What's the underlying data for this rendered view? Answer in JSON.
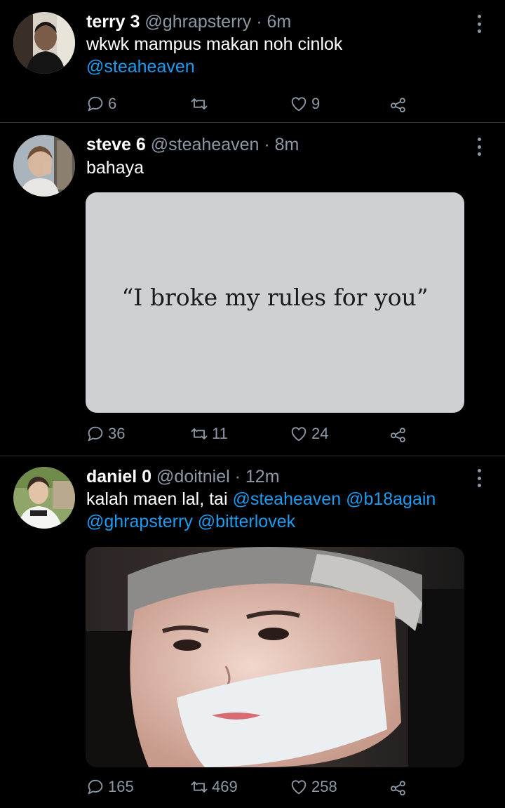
{
  "tweets": [
    {
      "name": "terry 3",
      "handle": "@ghrapsterry",
      "time": "· 6m",
      "text": "wkwk mampus makan noh cinlok",
      "mentions_line": "@steaheaven",
      "replies": "6",
      "retweets": "",
      "likes": "9"
    },
    {
      "name": "steve 6",
      "handle": "@steaheaven",
      "time": "· 8m",
      "text": "bahaya",
      "image_quote": "“I broke my rules for you”",
      "replies": "36",
      "retweets": "11",
      "likes": "24"
    },
    {
      "name": "daniel 0",
      "handle": "@doitniel",
      "time": "· 12m",
      "text_prefix": "kalah maen lal, tai ",
      "mention_a": "@steaheaven",
      "mention_b": "@b18again",
      "mention_c": "@ghrapsterry",
      "mention_d": "@bitterlovek",
      "replies": "165",
      "retweets": "469",
      "likes": "258"
    }
  ],
  "colors": {
    "background": "#000000",
    "mention": "#1d9bf0",
    "muted": "#8b98a5",
    "divider": "#2f3336",
    "quote_card": "#cfd0d4"
  },
  "icons": [
    "reply-icon",
    "retweet-icon",
    "like-icon",
    "share-icon",
    "more-icon"
  ]
}
